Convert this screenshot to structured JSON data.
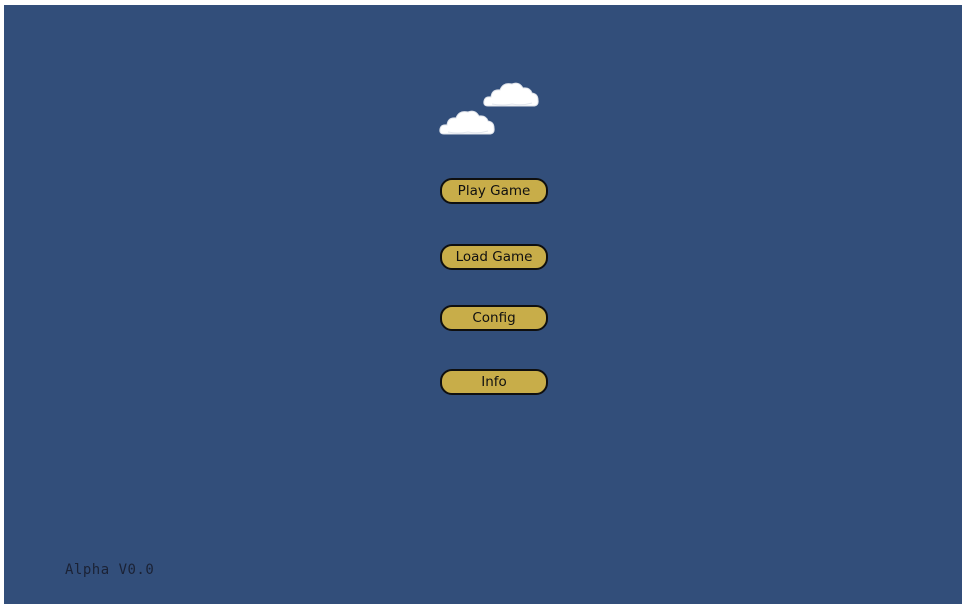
{
  "colors": {
    "background": "#324e7a",
    "button_fill": "#c8ad49",
    "button_border": "#0f0f0f",
    "cloud": "#ffffff",
    "version_text": "#1b2235"
  },
  "decorations": {
    "clouds": [
      "cloud-icon",
      "cloud-icon"
    ]
  },
  "menu": {
    "buttons": [
      {
        "label": "Play Game"
      },
      {
        "label": "Load Game"
      },
      {
        "label": "Config"
      },
      {
        "label": "Info"
      }
    ]
  },
  "footer": {
    "version": "Alpha V0.0"
  }
}
